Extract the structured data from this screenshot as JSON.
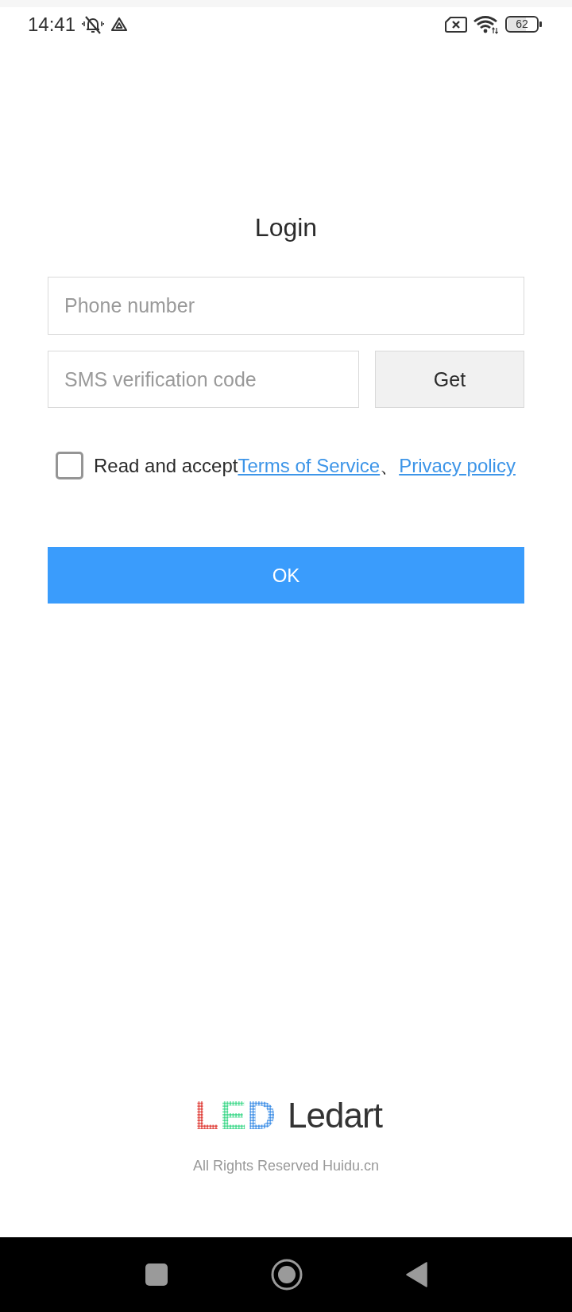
{
  "status_bar": {
    "time": "14:41",
    "battery": "62"
  },
  "title": "Login",
  "phone_field": {
    "placeholder": "Phone number"
  },
  "code_field": {
    "placeholder": "SMS verification code"
  },
  "get_button": "Get",
  "agreement": {
    "checked": false,
    "prefix": "Read and accept",
    "links": [
      "Terms of Service",
      "Privacy policy"
    ],
    "separator": "、"
  },
  "ok_button": "OK",
  "footer": {
    "logo_mark": "LED",
    "logo_name": "Ledart",
    "copyright": "All Rights Reserved Huidu.cn"
  }
}
